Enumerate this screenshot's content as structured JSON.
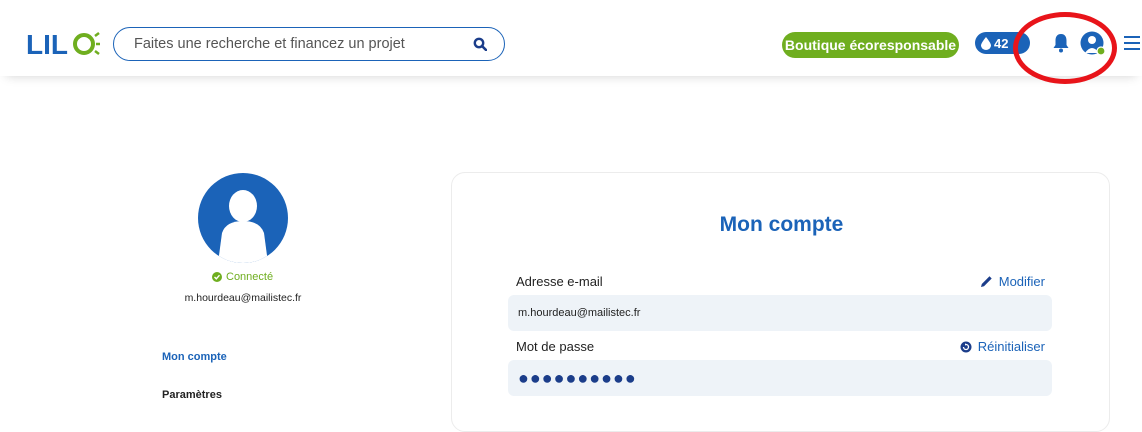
{
  "header": {
    "logo_text": "LILO",
    "search_placeholder": "Faites une recherche et financez un projet",
    "shop_label": "Boutique écoresponsable",
    "drops_count": "42",
    "icons": {
      "search": "search-icon",
      "drop": "water-drop-icon",
      "bell": "bell-icon",
      "avatar": "user-avatar-icon",
      "menu": "hamburger-menu-icon"
    }
  },
  "sidebar": {
    "status": "Connecté",
    "email": "m.hourdeau@mailistec.fr",
    "nav": [
      {
        "label": "Mon compte",
        "active": true
      },
      {
        "label": "Paramètres",
        "active": false
      }
    ]
  },
  "account": {
    "title": "Mon compte",
    "email_label": "Adresse e-mail",
    "email_action": "Modifier",
    "email_value": "m.hourdeau@mailistec.fr",
    "password_label": "Mot de passe",
    "password_action": "Réinitialiser",
    "password_mask": "●●●●●●●●●●"
  },
  "colors": {
    "brand_blue": "#1b63b8",
    "brand_green": "#6fae1f",
    "annotation_red": "#e8141a"
  }
}
